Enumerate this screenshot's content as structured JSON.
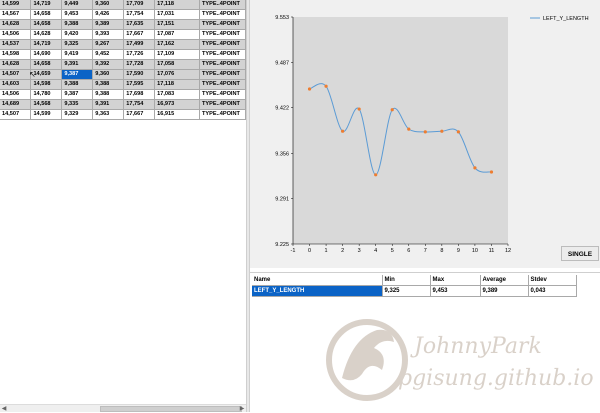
{
  "grid": {
    "rows": [
      [
        "14,599",
        "14,719",
        "9,449",
        "9,360",
        "17,709",
        "17,118",
        "TYPE..4POINT"
      ],
      [
        "14,567",
        "14,658",
        "9,453",
        "9,426",
        "17,754",
        "17,031",
        "TYPE..4POINT"
      ],
      [
        "14,628",
        "14,658",
        "9,388",
        "9,389",
        "17,635",
        "17,151",
        "TYPE..4POINT"
      ],
      [
        "14,506",
        "14,628",
        "9,420",
        "9,393",
        "17,667",
        "17,087",
        "TYPE..4POINT"
      ],
      [
        "14,537",
        "14,719",
        "9,325",
        "9,267",
        "17,499",
        "17,162",
        "TYPE..4POINT"
      ],
      [
        "14,598",
        "14,690",
        "9,419",
        "9,452",
        "17,726",
        "17,109",
        "TYPE..4POINT"
      ],
      [
        "14,628",
        "14,658",
        "9,391",
        "9,392",
        "17,728",
        "17,058",
        "TYPE..4POINT"
      ],
      [
        "14,507",
        "14,659",
        "9,387",
        "9,360",
        "17,590",
        "17,076",
        "TYPE..4POINT"
      ],
      [
        "14,603",
        "14,598",
        "9,388",
        "9,388",
        "17,595",
        "17,118",
        "TYPE..4POINT"
      ],
      [
        "14,506",
        "14,780",
        "9,387",
        "9,388",
        "17,698",
        "17,083",
        "TYPE..4POINT"
      ],
      [
        "14,689",
        "14,568",
        "9,335",
        "9,391",
        "17,754",
        "16,973",
        "TYPE..4POINT"
      ],
      [
        "14,507",
        "14,599",
        "9,329",
        "9,363",
        "17,667",
        "16,915",
        "TYPE..4POINT"
      ]
    ]
  },
  "chart": {
    "single_label": "SINGLE",
    "legend_color": "#5b9bd5",
    "marker_color": "#ed7d31"
  },
  "chart_data": {
    "type": "line",
    "x": [
      0,
      1,
      2,
      3,
      4,
      5,
      6,
      7,
      8,
      9,
      10,
      11
    ],
    "series": [
      {
        "name": "LEFT_Y_LENGTH",
        "values": [
          9.449,
          9.453,
          9.388,
          9.42,
          9.325,
          9.419,
          9.391,
          9.387,
          9.388,
          9.387,
          9.335,
          9.329
        ]
      }
    ],
    "xlim": [
      -1,
      12
    ],
    "ylim": [
      9.225,
      9.553
    ],
    "xticks": [
      "-1",
      "0",
      "1",
      "2",
      "3",
      "4",
      "5",
      "6",
      "7",
      "8",
      "9",
      "10",
      "11",
      "12"
    ],
    "yticks": [
      "9.553",
      "9.487",
      "9.422",
      "9.356",
      "9.291",
      "9.225"
    ],
    "ytick_values": [
      9.553,
      9.487,
      9.422,
      9.356,
      9.291,
      9.225
    ],
    "legend": "top-right",
    "grid": false
  },
  "stats": {
    "headers": {
      "name": "Name",
      "min": "Min",
      "max": "Max",
      "average": "Average",
      "stdev": "Stdev"
    },
    "row": {
      "name": "LEFT_Y_LENGTH",
      "min": "9,325",
      "max": "9,453",
      "average": "9,389",
      "stdev": "0,043"
    }
  },
  "watermark": {
    "name": "JohnnyPark",
    "site": "pgisung.github.io"
  }
}
